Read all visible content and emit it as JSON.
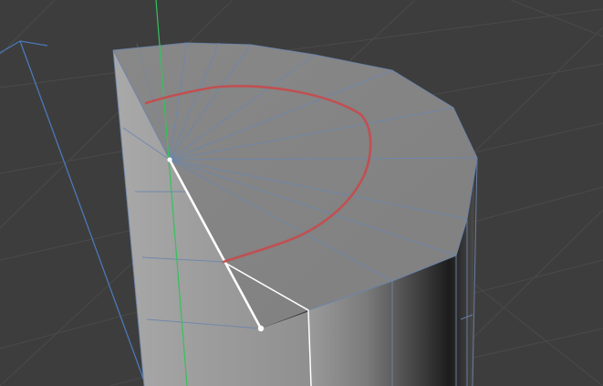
{
  "viewport": {
    "background": "#3d3d3d",
    "grid_color": "#4a4a4a",
    "axis_x_color": "#4b78b8",
    "axis_y_color": "#33c25c",
    "wire_color": "#6c86ad",
    "selected_color": "#ffffff",
    "tool_color": "#c34d4f"
  },
  "objects": [
    {
      "name": "cylinder-mesh",
      "type": "polygon-mesh",
      "state": "selected-edge"
    }
  ]
}
